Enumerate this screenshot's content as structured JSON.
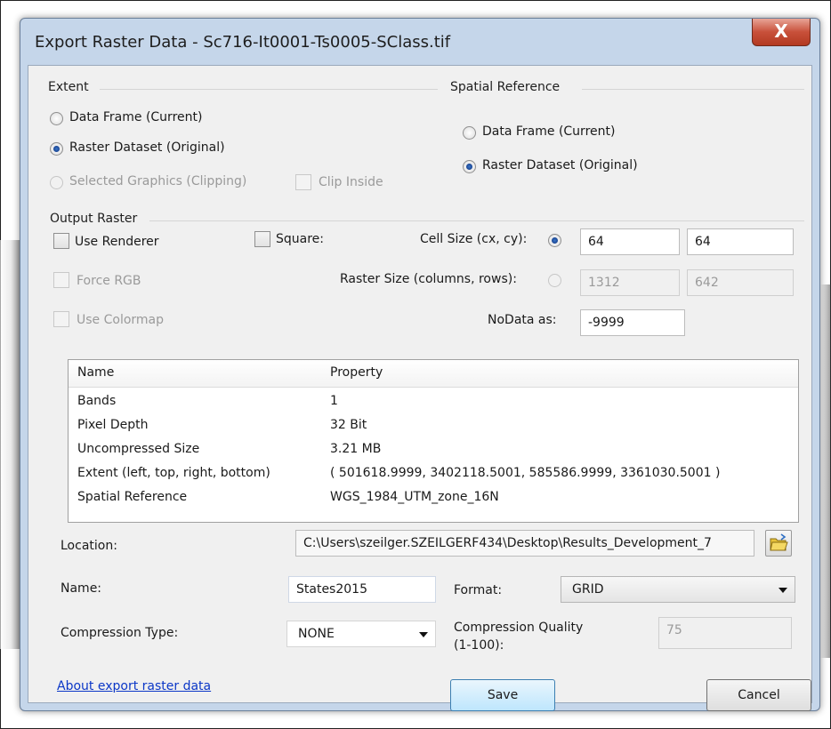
{
  "window": {
    "title": "Export Raster Data - Sc716-It0001-Ts0005-SClass.tif",
    "close_glyph": "X"
  },
  "extent": {
    "label": "Extent",
    "data_frame": "Data Frame (Current)",
    "raster_dataset": "Raster Dataset (Original)",
    "selected_graphics": "Selected Graphics (Clipping)",
    "clip_inside": "Clip Inside"
  },
  "spatial_reference": {
    "label": "Spatial Reference",
    "data_frame": "Data Frame (Current)",
    "raster_dataset": "Raster Dataset (Original)"
  },
  "output_raster": {
    "label": "Output Raster",
    "use_renderer": "Use Renderer",
    "square": "Square:",
    "force_rgb": "Force RGB",
    "use_colormap": "Use Colormap",
    "cell_size_label": "Cell Size (cx, cy):",
    "cell_size_x": "64",
    "cell_size_y": "64",
    "raster_size_label": "Raster Size (columns, rows):",
    "columns": "1312",
    "rows": "642",
    "nodata_label": "NoData as:",
    "nodata_value": "-9999"
  },
  "properties": {
    "headers": [
      "Name",
      "Property"
    ],
    "rows": [
      [
        "Bands",
        "1"
      ],
      [
        "Pixel Depth",
        "32 Bit"
      ],
      [
        "Uncompressed Size",
        "3.21 MB"
      ],
      [
        "Extent (left, top, right, bottom)",
        "( 501618.9999, 3402118.5001, 585586.9999, 3361030.5001 )"
      ],
      [
        "Spatial Reference",
        "WGS_1984_UTM_zone_16N"
      ]
    ]
  },
  "location": {
    "label": "Location:",
    "value": "C:\\Users\\szeilger.SZEILGERF434\\Desktop\\Results_Development_7"
  },
  "name": {
    "label": "Name:",
    "value": "States2015"
  },
  "format": {
    "label": "Format:",
    "value": "GRID"
  },
  "compression": {
    "type_label": "Compression Type:",
    "type_value": "NONE",
    "quality_label_1": "Compression Quality",
    "quality_label_2": "(1-100):",
    "quality_value": "75"
  },
  "footer": {
    "about_link": "About export raster data",
    "save": "Save",
    "cancel": "Cancel"
  },
  "colors": {
    "link": "#0b37c7",
    "window_frame": "#c5d6ea",
    "close": "#c8503a"
  }
}
